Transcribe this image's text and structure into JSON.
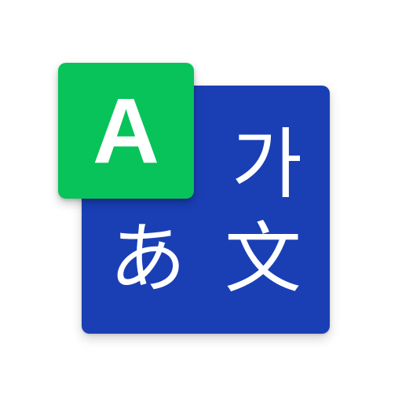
{
  "icon": {
    "semantic": "translate-icon",
    "colors": {
      "back_tile": "#1a3fb5",
      "front_tile": "#08c35a",
      "glyph": "#ffffff"
    },
    "glyphs": {
      "latin": "A",
      "korean": "가",
      "japanese": "あ",
      "chinese": "文"
    }
  }
}
